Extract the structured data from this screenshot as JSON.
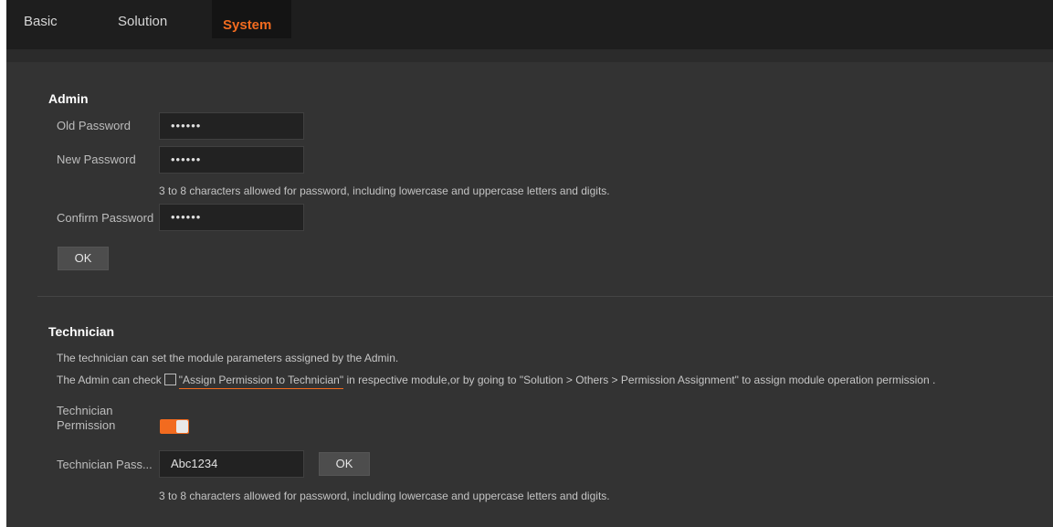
{
  "tabs": {
    "basic": "Basic",
    "solution": "Solution",
    "system": "System"
  },
  "admin": {
    "title": "Admin",
    "old_password_label": "Old Password",
    "old_password_value": "••••••",
    "new_password_label": "New Password",
    "new_password_value": "••••••",
    "password_hint": "3 to 8 characters allowed for password, including lowercase and uppercase letters and digits.",
    "confirm_password_label": "Confirm Password",
    "confirm_password_value": "••••••",
    "ok_label": "OK"
  },
  "technician": {
    "title": "Technician",
    "description_1": "The technician can set the module parameters assigned by the Admin.",
    "description_2_prefix": "The Admin can check",
    "description_2_link": "\"Assign Permission to Technician\"",
    "description_2_suffix": "in respective module,or by going to \"Solution > Others > Permission Assignment\" to assign module operation permission .",
    "permission_label_line1": "Technician",
    "permission_label_line2": "Permission",
    "permission_enabled": true,
    "password_label": "Technician Pass...",
    "password_value": "Abc1234",
    "ok_label": "OK",
    "password_hint": "3 to 8 characters allowed for password, including lowercase and uppercase letters and digits."
  },
  "colors": {
    "accent": "#f26b1f",
    "background": "#333333",
    "topbar": "#1e1e1e"
  }
}
